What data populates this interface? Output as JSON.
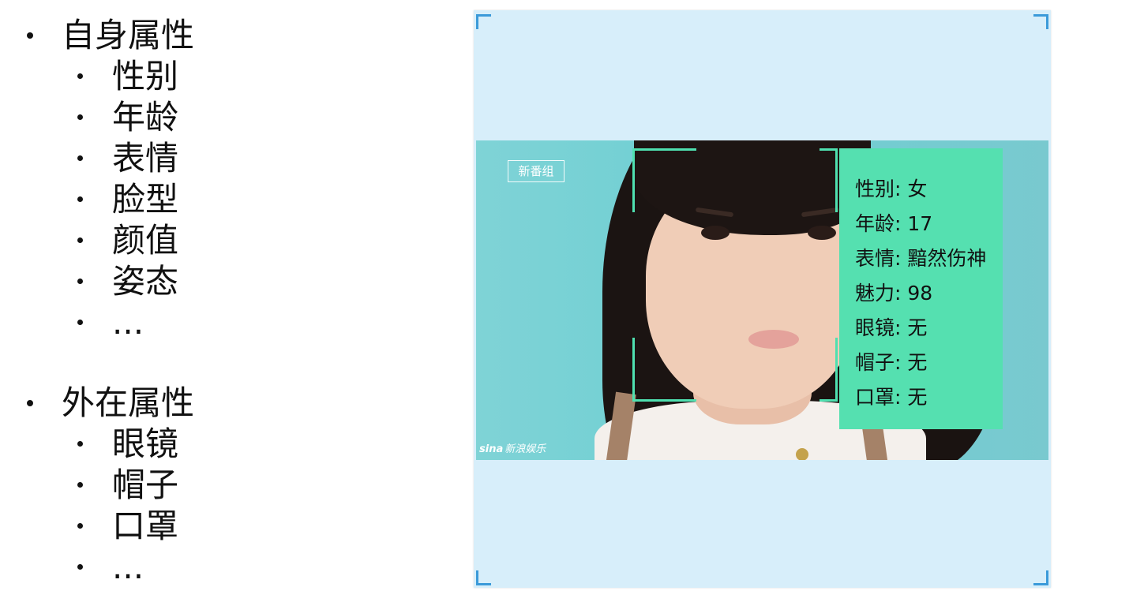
{
  "intrinsic": {
    "title": "自身属性",
    "items": [
      "性别",
      "年龄",
      "表情",
      "脸型",
      "颜值",
      "姿态",
      "..."
    ]
  },
  "extrinsic": {
    "title": "外在属性",
    "items": [
      "眼镜",
      "帽子",
      "口罩",
      "..."
    ]
  },
  "photo": {
    "watermark": "新番组",
    "brand_logo": "sina",
    "brand_text": "新浪娱乐"
  },
  "result_panel": {
    "rows": [
      {
        "label": "性别",
        "value": "女"
      },
      {
        "label": "年龄",
        "value": "17"
      },
      {
        "label": "表情",
        "value": "黯然伤神"
      },
      {
        "label": "魅力",
        "value": "98"
      },
      {
        "label": "眼镜",
        "value": "无"
      },
      {
        "label": "帽子",
        "value": "无"
      },
      {
        "label": "口罩",
        "value": "无"
      }
    ]
  },
  "colors": {
    "panel_bg": "#d7eefa",
    "photo_bg": "#79c9cf",
    "face_box": "#4fe0b0",
    "info_bg": "#55e0b0",
    "corner_marker": "#3b9ad9"
  }
}
